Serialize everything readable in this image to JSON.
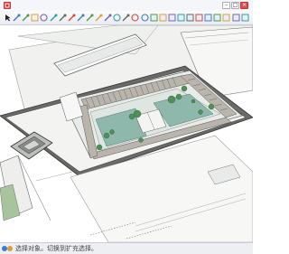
{
  "window": {
    "title": "",
    "minimize_icon": "minimize-icon",
    "maximize_icon": "maximize-icon",
    "close_icon": "close-icon"
  },
  "toolbar": {
    "tools": [
      "select-arrow-icon",
      "eraser-icon",
      "line-pencil-icon",
      "rectangle-icon",
      "circle-icon",
      "push-pull-icon",
      "move-icon",
      "rotate-icon",
      "scale-icon",
      "offset-icon",
      "tape-measure-icon",
      "paint-bucket-icon",
      "orbit-icon",
      "pan-icon",
      "zoom-icon",
      "zoom-extents-icon",
      "iso-view-icon",
      "top-view-icon",
      "front-view-icon",
      "right-view-icon",
      "back-view-icon",
      "left-view-icon",
      "xray-icon",
      "wireframe-icon",
      "hidden-line-icon",
      "shaded-icon",
      "textured-icon"
    ]
  },
  "statusbar": {
    "text": "选择对象。切换到扩充选择。"
  },
  "colors": {
    "roof_gray": "#cfd2d2",
    "wall_dark": "#5d5d5a",
    "courtyard_teal": "#8fb8ad",
    "pond_teal": "#6ea79d",
    "tree_green": "#4f8f58"
  }
}
